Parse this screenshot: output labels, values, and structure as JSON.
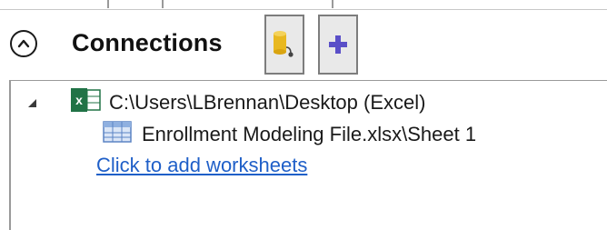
{
  "panel": {
    "title": "Connections",
    "toolbar": {
      "collapse_icon": "chevron-up-icon",
      "add_connection_icon": "database-connect-icon",
      "add_icon": "plus-icon"
    }
  },
  "tree": {
    "connection": {
      "label": "C:\\Users\\LBrennan\\Desktop (Excel)",
      "icon": "excel-icon",
      "expanded": true
    },
    "sheet": {
      "label": "Enrollment Modeling File.xlsx\\Sheet 1",
      "icon": "table-icon"
    },
    "add_link": "Click to add worksheets"
  },
  "colors": {
    "excel_green": "#217346",
    "link_blue": "#1f5fc8",
    "plus_purple": "#5a4fc8",
    "db_gold": "#e8b820"
  }
}
